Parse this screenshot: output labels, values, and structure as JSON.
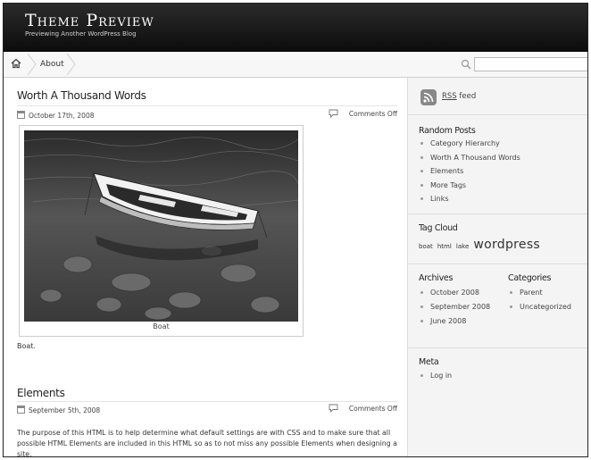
{
  "header": {
    "title": "Theme Preview",
    "tagline": "Previewing Another WordPress Blog"
  },
  "nav": {
    "home_icon": "home-icon",
    "items": [
      {
        "label": "About"
      }
    ],
    "search": {
      "placeholder": "",
      "icon": "search-icon"
    }
  },
  "posts": [
    {
      "title": "Worth A Thousand Words",
      "date": "October 17th, 2008",
      "comments": "Comments Off",
      "image_caption": "Boat",
      "excerpt": "Boat."
    },
    {
      "title": "Elements",
      "date": "September 5th, 2008",
      "comments": "Comments Off",
      "body": "The purpose of this HTML is to help determine what default settings are with CSS and to make sure that all possible HTML Elements are included in this HTML so as to not miss any possible Elements when designing a site."
    }
  ],
  "sidebar": {
    "rss": {
      "abbr": "RSS",
      "label": " feed"
    },
    "random_posts": {
      "heading": "Random Posts",
      "items": [
        "Category Hierarchy",
        "Worth A Thousand Words",
        "Elements",
        "More Tags",
        "Links"
      ]
    },
    "tag_cloud": {
      "heading": "Tag Cloud",
      "tags": [
        "boat",
        "html",
        "lake",
        "wordpress"
      ]
    },
    "archives": {
      "heading": "Archives",
      "items": [
        "October 2008",
        "September 2008",
        "June 2008"
      ]
    },
    "categories": {
      "heading": "Categories",
      "items": [
        "Parent",
        "Uncategorized"
      ]
    },
    "meta": {
      "heading": "Meta",
      "items": [
        "Log in"
      ]
    }
  }
}
